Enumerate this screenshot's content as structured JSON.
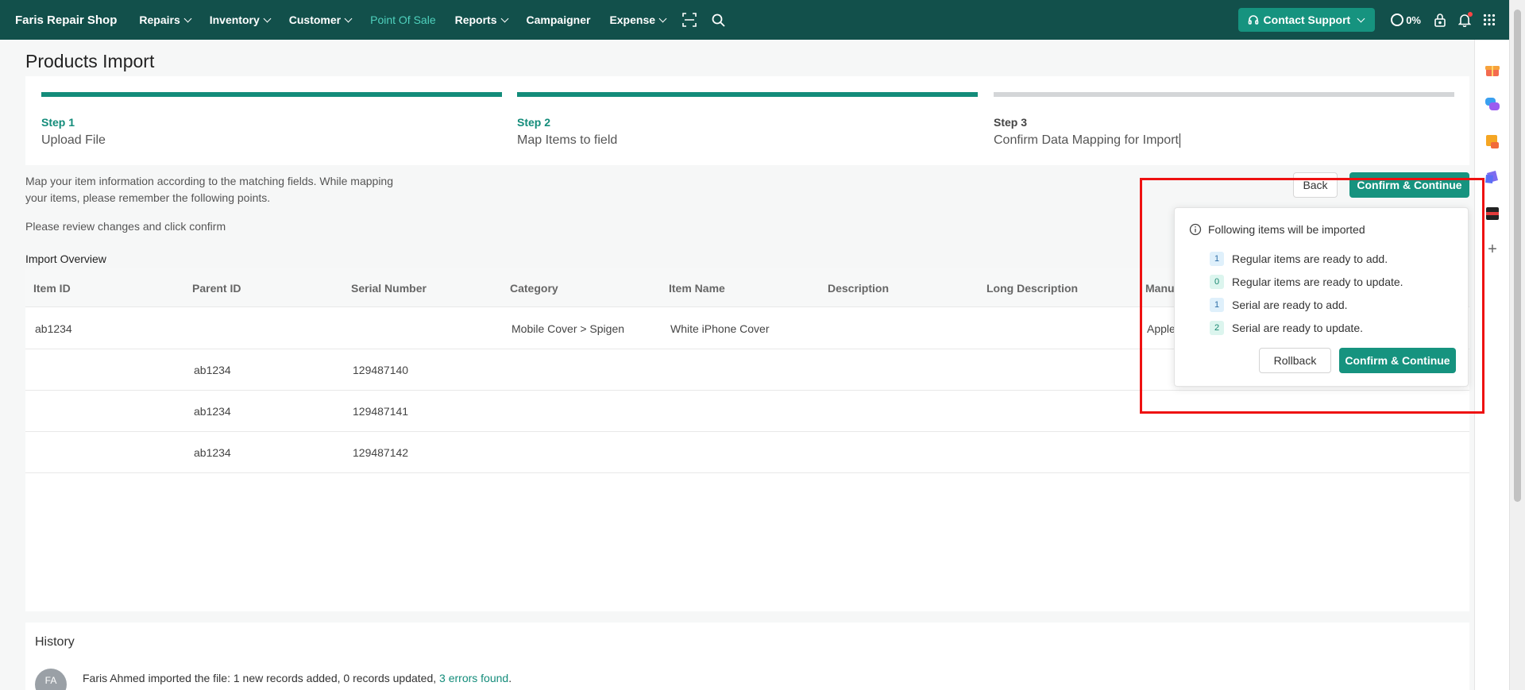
{
  "app": {
    "brand": "Faris Repair Shop"
  },
  "nav": {
    "items": [
      {
        "label": "Repairs",
        "dropdown": true
      },
      {
        "label": "Inventory",
        "dropdown": true
      },
      {
        "label": "Customer",
        "dropdown": true
      },
      {
        "label": "Point Of Sale",
        "dropdown": false,
        "active": true
      },
      {
        "label": "Reports",
        "dropdown": true
      },
      {
        "label": "Campaigner",
        "dropdown": false
      },
      {
        "label": "Expense",
        "dropdown": true
      }
    ],
    "icons": [
      "scan-icon",
      "search-icon"
    ]
  },
  "topbar": {
    "support_label": "Contact Support",
    "progress": "0%",
    "icons": [
      "progress-ring-icon",
      "lock-icon",
      "bell-icon",
      "apps-grid-icon"
    ]
  },
  "page": {
    "title": "Products Import"
  },
  "steps": [
    {
      "number": "Step 1",
      "label": "Upload File",
      "complete": true
    },
    {
      "number": "Step 2",
      "label": "Map Items to field",
      "complete": true
    },
    {
      "number": "Step 3",
      "label": "Confirm Data Mapping for Import",
      "complete": false
    }
  ],
  "intro": {
    "text": "Map your item information according to the matching fields. While mapping your items, please remember the following points.",
    "review": "Please review changes and click confirm",
    "overview_label": "Import Overview"
  },
  "actions": {
    "back_label": "Back",
    "confirm_label": "Confirm & Continue"
  },
  "table": {
    "columns": [
      "Item ID",
      "Parent ID",
      "Serial Number",
      "Category",
      "Item Name",
      "Description",
      "Long Description",
      "Manu"
    ],
    "rows": [
      [
        "ab1234",
        "",
        "",
        "Mobile Cover > Spigen",
        "White iPhone Cover",
        "",
        "",
        "Apple"
      ],
      [
        "",
        "ab1234",
        "129487140",
        "",
        "",
        "",
        "",
        ""
      ],
      [
        "",
        "ab1234",
        "129487141",
        "",
        "",
        "",
        "",
        ""
      ],
      [
        "",
        "ab1234",
        "129487142",
        "",
        "",
        "",
        "",
        ""
      ]
    ]
  },
  "popup": {
    "title": "Following items will be imported",
    "items": [
      {
        "count": "1",
        "text": "Regular items are ready to add.",
        "color": "blue"
      },
      {
        "count": "0",
        "text": "Regular items are ready to update.",
        "color": "green"
      },
      {
        "count": "1",
        "text": "Serial are ready to add.",
        "color": "blue"
      },
      {
        "count": "2",
        "text": "Serial are ready to update.",
        "color": "green"
      }
    ],
    "rollback_label": "Rollback",
    "confirm_label": "Confirm & Continue"
  },
  "history": {
    "title": "History",
    "avatar_initials": "FA",
    "text": "Faris Ahmed imported the file: 1 new records added, 0 records updated, ",
    "link": "3 errors found",
    "suffix": "."
  },
  "colors": {
    "navbar": "#12504b",
    "accent": "#16937f",
    "active_nav": "#4fd1bd",
    "highlight": "#ee1111"
  }
}
